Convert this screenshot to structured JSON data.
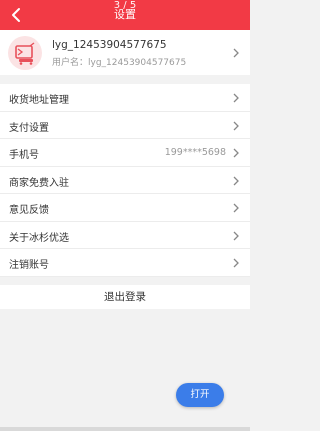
{
  "header": {
    "title": "设置",
    "page_indicator": "3 / 5",
    "back_icon": "chevron-left-icon",
    "background": "#f23a45"
  },
  "profile": {
    "name": "lyg_12453904577675",
    "username": "用户名：lyg_12453904577675",
    "avatar_icon": "shop-cart-avatar-icon"
  },
  "settings": [
    {
      "label": "收货地址管理"
    },
    {
      "label": "支付设置"
    },
    {
      "label": "手机号",
      "value": "199****5698"
    },
    {
      "label": "商家免费入驻"
    },
    {
      "label": "意见反馈"
    },
    {
      "label": "关于冰杉优选"
    },
    {
      "label": "注销账号"
    }
  ],
  "logout_label": "退出登录",
  "open_button_label": "打开",
  "colors": {
    "accent": "#f23a45",
    "button_blue": "#3b7de9",
    "background": "#f2f2f2"
  }
}
